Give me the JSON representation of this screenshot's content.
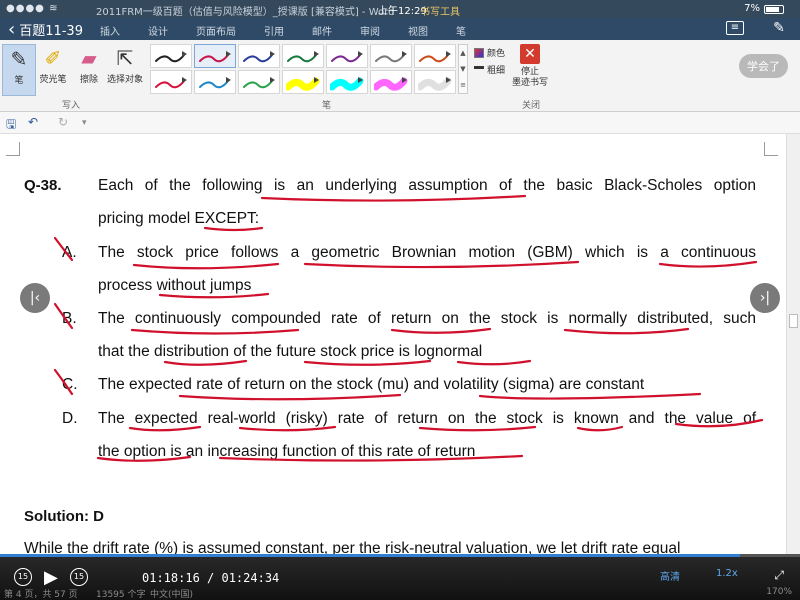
{
  "status": {
    "title": "2011FRM一级百题（估值与风险模型）_授课版 [兼容模式] - Word",
    "time": "上午12:29",
    "context_tab": "书写工具",
    "battery": "7%"
  },
  "header": {
    "back_label": "百题11-39",
    "menu": [
      "插入",
      "设计",
      "页面布局",
      "引用",
      "邮件",
      "审阅",
      "视图",
      "笔"
    ]
  },
  "ribbon": {
    "tools": [
      "笔",
      "荧光笔",
      "擦除",
      "选择对象"
    ],
    "group_write": "写入",
    "group_pen": "笔",
    "color_label": "颜色",
    "thickness_label": "粗细",
    "stop_label_1": "停止",
    "stop_label_2": "墨迹书写",
    "group_close": "关闭",
    "pen_colors": [
      "#222222",
      "#c8144d",
      "#2b3f9e",
      "#1b7a3e",
      "#7a2a8f",
      "#7a7a7a",
      "#cc4d1a",
      "#d4143c",
      "#1f88c9",
      "#2aa34a",
      "#ffff00",
      "#00ffff",
      "#ff66ff",
      "#e0e0e0"
    ],
    "learned": "学会了"
  },
  "doc": {
    "qnum": "Q-38.",
    "q_line1": "Each of the following is an underlying assumption of the basic Black-Scholes option",
    "q_line2": "pricing model EXCEPT:",
    "opt_a_letter": "A.",
    "opt_a_line1": "The stock price follows a geometric Brownian motion (GBM) which is a continuous",
    "opt_a_line2": "process without jumps",
    "opt_b_letter": "B.",
    "opt_b_line1": "The continuously compounded rate of return on the stock is normally distributed, such",
    "opt_b_line2": "that the distribution of the future stock price is lognormal",
    "opt_c_letter": "C.",
    "opt_c_line1": "The expected rate of return on the stock (mu) and volatility (sigma) are constant",
    "opt_d_letter": "D.",
    "opt_d_line1": "The expected real-world (risky) rate of return on the stock is known and the value of",
    "opt_d_line2": "the option is an increasing function of this rate of return",
    "solution": "Solution: D",
    "next_line": "While the drift rate (%) is assumed constant, per the risk-neutral valuation, we let drift rate equal"
  },
  "player": {
    "skip_back": "15",
    "skip_fwd": "15",
    "current_time": "01:18:16",
    "total_time": "01:24:34",
    "progress": 0.925,
    "quality": "高清",
    "speed": "1.2x"
  },
  "wordstatus": {
    "page": "第 4 页，共 57 页",
    "words": "13595 个字",
    "lang": "中文(中国)",
    "zoom": "170%"
  }
}
